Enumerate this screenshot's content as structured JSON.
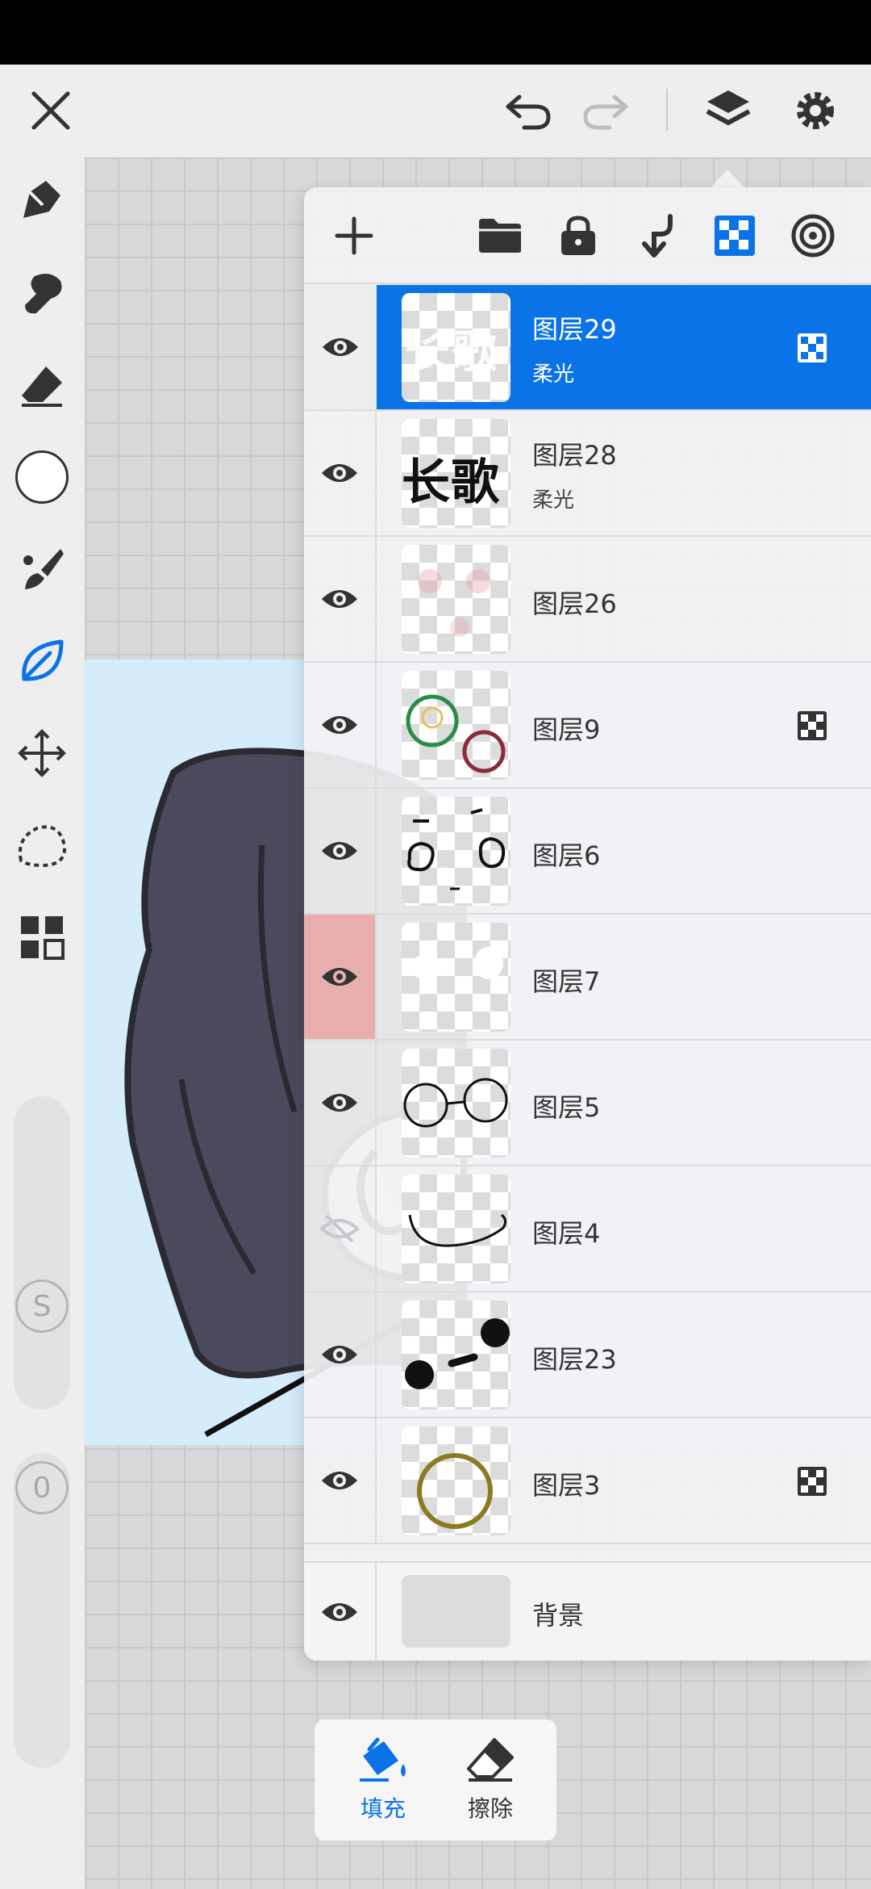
{
  "toolbar": {
    "icons": [
      "close-icon",
      "undo-icon",
      "redo-icon",
      "layers-icon",
      "settings-icon"
    ],
    "accent_color": "#0a73e8"
  },
  "left_rail": {
    "tools": [
      "pen-icon",
      "smudge-icon",
      "eraser-icon",
      "color-circle-icon",
      "brush-icon",
      "leaf-icon",
      "move-icon",
      "lasso-icon",
      "grid-icon"
    ],
    "size_label": "S",
    "opacity_label": "0"
  },
  "layers_panel": {
    "toolbar_icons": [
      "add-layer-icon",
      "folder-icon",
      "lock-icon",
      "merge-down-icon",
      "clipping-mask-icon",
      "target-icon"
    ],
    "layers": [
      {
        "name": "图层29",
        "mode": "柔光",
        "selected": true,
        "thumb_text": "长歌"
      },
      {
        "name": "图层28",
        "mode": "柔光",
        "selected": false,
        "thumb_text": "长歌"
      },
      {
        "name": "图层26",
        "mode": "",
        "selected": false
      },
      {
        "name": "图层9",
        "mode": "",
        "selected": false
      },
      {
        "name": "图层6",
        "mode": "",
        "selected": false
      },
      {
        "name": "图层7",
        "mode": "",
        "selected": false
      },
      {
        "name": "图层5",
        "mode": "",
        "selected": false
      },
      {
        "name": "图层4",
        "mode": "",
        "selected": false
      },
      {
        "name": "图层23",
        "mode": "",
        "selected": false
      },
      {
        "name": "图层3",
        "mode": "",
        "selected": false
      }
    ],
    "background": {
      "name": "背景"
    }
  },
  "bottom_tools": {
    "fill_label": "填充",
    "erase_label": "擦除"
  }
}
